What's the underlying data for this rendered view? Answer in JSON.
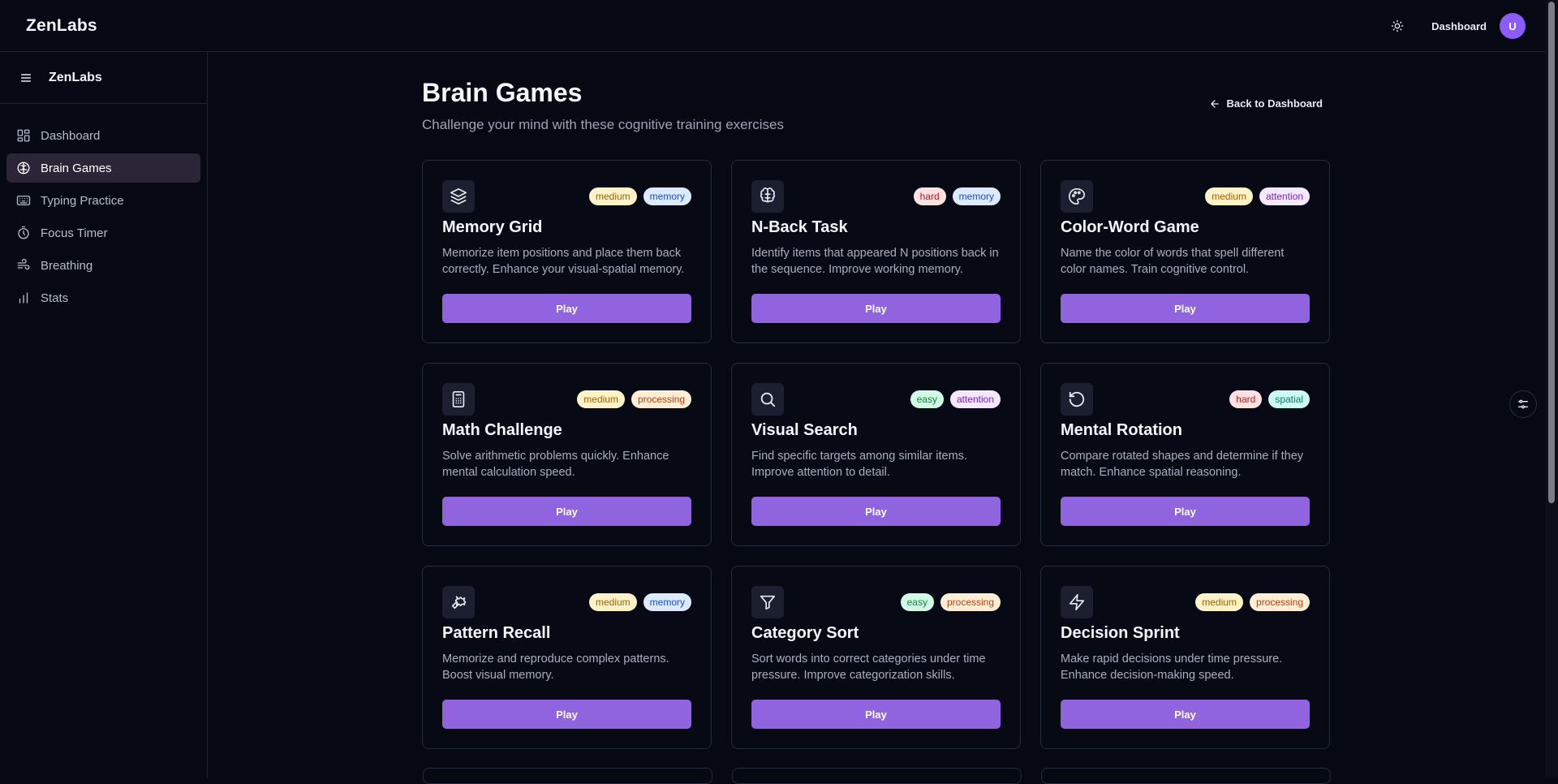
{
  "header": {
    "brand": "ZenLabs",
    "dashboard_link": "Dashboard",
    "avatar_initial": "U"
  },
  "sidebar": {
    "brand": "ZenLabs",
    "items": [
      {
        "label": "Dashboard",
        "icon": "dashboard-icon"
      },
      {
        "label": "Brain Games",
        "icon": "brain-icon"
      },
      {
        "label": "Typing Practice",
        "icon": "keyboard-icon"
      },
      {
        "label": "Focus Timer",
        "icon": "timer-icon"
      },
      {
        "label": "Breathing",
        "icon": "wind-icon"
      },
      {
        "label": "Stats",
        "icon": "bar-chart-icon"
      }
    ],
    "active_index": 1
  },
  "page": {
    "title": "Brain Games",
    "subtitle": "Challenge your mind with these cognitive training exercises",
    "back_label": "Back to Dashboard"
  },
  "badge_colors": {
    "easy": {
      "bg": "#d1fae5",
      "fg": "#15803d"
    },
    "medium": {
      "bg": "#fef3c7",
      "fg": "#a16207"
    },
    "hard": {
      "bg": "#fee2e2",
      "fg": "#b91c1c"
    },
    "memory": {
      "bg": "#dbeafe",
      "fg": "#1d4ed8"
    },
    "attention": {
      "bg": "#f3e8ff",
      "fg": "#7e22ce"
    },
    "processing": {
      "bg": "#ffedd5",
      "fg": "#c2410c"
    },
    "spatial": {
      "bg": "#ccfbf1",
      "fg": "#0f766e"
    }
  },
  "accent_color": "#9064de",
  "games": [
    {
      "title": "Memory Grid",
      "icon": "layers-icon",
      "difficulty": "medium",
      "category": "memory",
      "description": "Memorize item positions and place them back correctly. Enhance your visual-spatial memory.",
      "play_label": "Play"
    },
    {
      "title": "N-Back Task",
      "icon": "brain-icon",
      "difficulty": "hard",
      "category": "memory",
      "description": "Identify items that appeared N positions back in the sequence. Improve working memory.",
      "play_label": "Play"
    },
    {
      "title": "Color-Word Game",
      "icon": "palette-icon",
      "difficulty": "medium",
      "category": "attention",
      "description": "Name the color of words that spell different color names. Train cognitive control.",
      "play_label": "Play"
    },
    {
      "title": "Math Challenge",
      "icon": "calculator-icon",
      "difficulty": "medium",
      "category": "processing",
      "description": "Solve arithmetic problems quickly. Enhance mental calculation speed.",
      "play_label": "Play"
    },
    {
      "title": "Visual Search",
      "icon": "search-icon",
      "difficulty": "easy",
      "category": "attention",
      "description": "Find specific targets among similar items. Improve attention to detail.",
      "play_label": "Play"
    },
    {
      "title": "Mental Rotation",
      "icon": "rotate-icon",
      "difficulty": "hard",
      "category": "spatial",
      "description": "Compare rotated shapes and determine if they match. Enhance spatial reasoning.",
      "play_label": "Play"
    },
    {
      "title": "Pattern Recall",
      "icon": "puzzle-icon",
      "difficulty": "medium",
      "category": "memory",
      "description": "Memorize and reproduce complex patterns. Boost visual memory.",
      "play_label": "Play"
    },
    {
      "title": "Category Sort",
      "icon": "filter-icon",
      "difficulty": "easy",
      "category": "processing",
      "description": "Sort words into correct categories under time pressure. Improve categorization skills.",
      "play_label": "Play"
    },
    {
      "title": "Decision Sprint",
      "icon": "lightning-icon",
      "difficulty": "medium",
      "category": "processing",
      "description": "Make rapid decisions under time pressure. Enhance decision-making speed.",
      "play_label": "Play"
    }
  ]
}
